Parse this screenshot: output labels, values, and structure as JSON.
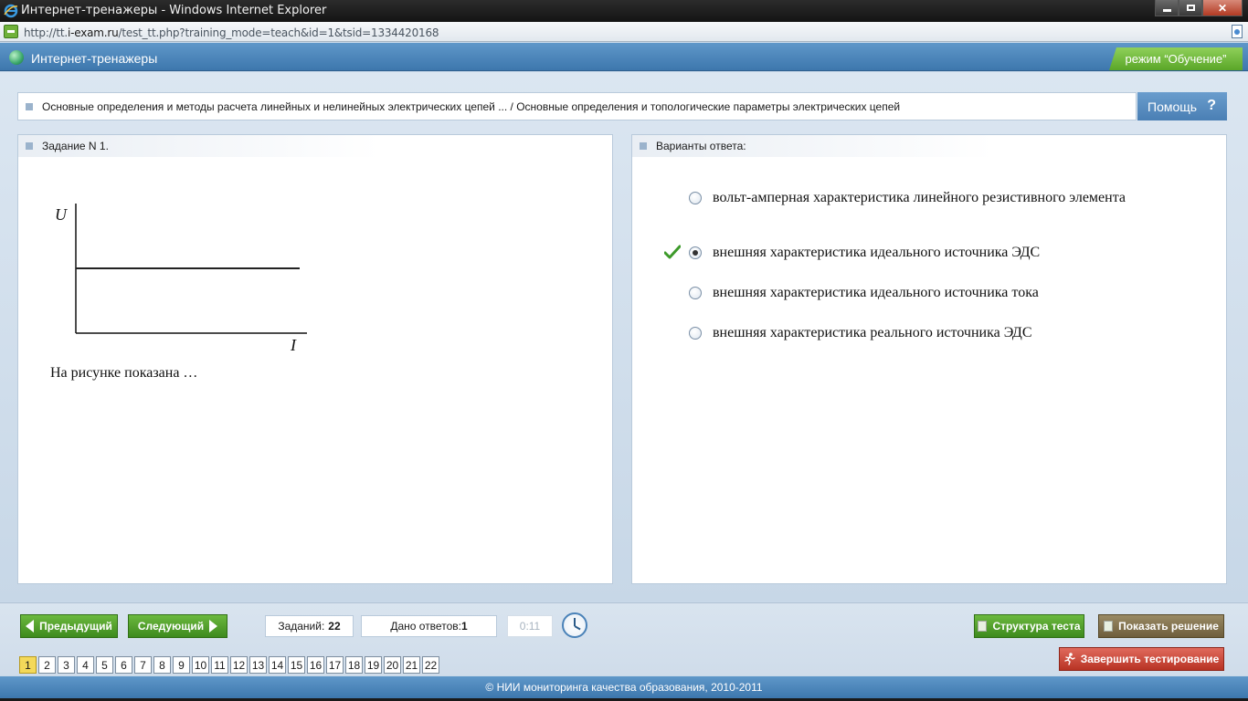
{
  "window": {
    "title": "Интернет-тренажеры - Windows Internet Explorer",
    "url_host": "http://tt.",
    "url_domain": "i-exam.ru",
    "url_path": "/test_tt.php?training_mode=teach&id=1&tsid=1334420168"
  },
  "header": {
    "app_title": "Интернет-тренажеры",
    "mode_label": "режим “Обучение”"
  },
  "breadcrumb": {
    "text": "Основные определения и методы расчета линейных и нелинейных электрических цепей ... / Основные определения и топологические параметры электрических цепей",
    "help_label": "Помощь",
    "help_glyph": "?"
  },
  "question": {
    "header": "Задание N 1.",
    "figure": {
      "y_axis_label": "U",
      "x_axis_label": "I"
    },
    "text": "На рисунке показана …"
  },
  "answers": {
    "header": "Варианты ответа:",
    "options": [
      {
        "text": "вольт-амперная характеристика линейного резистивного элемента",
        "selected": false
      },
      {
        "text": "внешняя характеристика идеального источника ЭДС",
        "selected": true
      },
      {
        "text": "внешняя характеристика идеального источника тока",
        "selected": false
      },
      {
        "text": "внешняя характеристика реального источника ЭДС",
        "selected": false
      }
    ]
  },
  "toolbar": {
    "prev_label": "Предыдущий",
    "next_label": "Следующий",
    "tasks_label": "Заданий:",
    "tasks_count": "22",
    "answers_label": "Дано ответов:",
    "answers_count": "1",
    "timer": "0:11",
    "structure_label": "Структура теста",
    "solution_label": "Показать решение",
    "finish_label": "Завершить тестирование",
    "pages": [
      "1",
      "2",
      "3",
      "4",
      "5",
      "6",
      "7",
      "8",
      "9",
      "10",
      "11",
      "12",
      "13",
      "14",
      "15",
      "16",
      "17",
      "18",
      "19",
      "20",
      "21",
      "22"
    ],
    "current_page": "1"
  },
  "footer": {
    "text": "© НИИ мониторинга качества образования, 2010-2011"
  },
  "colors": {
    "header_blue": "#4a82b8",
    "mode_green": "#6cb93e",
    "finish_red": "#c8402f",
    "active_page": "#f4d95a"
  }
}
